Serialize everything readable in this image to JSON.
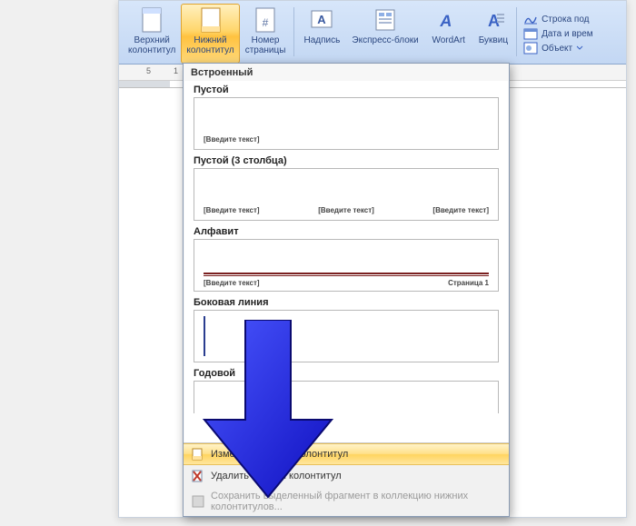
{
  "ribbon": {
    "header_top": {
      "label1": "Верхний",
      "label2": "колонтитул"
    },
    "header_bottom": {
      "label1": "Нижний",
      "label2": "колонтитул"
    },
    "page_number": {
      "label1": "Номер",
      "label2": "страницы"
    },
    "text_box": {
      "label": "Надпись"
    },
    "quick_parts": {
      "label": "Экспресс-блоки"
    },
    "wordart": {
      "label": "WordArt"
    },
    "drop_cap": {
      "label": "Буквиц"
    },
    "sig_line": {
      "label": "Строка под"
    },
    "date_time": {
      "label": "Дата и врем"
    },
    "object": {
      "label": "Объект"
    }
  },
  "ruler": {
    "mark1": "5",
    "mark2": "1"
  },
  "dropdown": {
    "section_header": "Встроенный",
    "items": [
      {
        "title": "Пустой",
        "ph1": "[Введите текст]"
      },
      {
        "title": "Пустой (3 столбца)",
        "ph1": "[Введите текст]",
        "ph2": "[Введите текст]",
        "ph3": "[Введите текст]"
      },
      {
        "title": "Алфавит",
        "ph1": "[Введите текст]",
        "page": "Страница 1"
      },
      {
        "title": "Боковая линия"
      },
      {
        "title": "Годовой"
      }
    ],
    "action_edit": "Изменить нижний колонтитул",
    "action_remove": "Удалить нижний колонтитул",
    "action_save": "Сохранить выделенный фрагмент в коллекцию нижних колонтитулов..."
  }
}
